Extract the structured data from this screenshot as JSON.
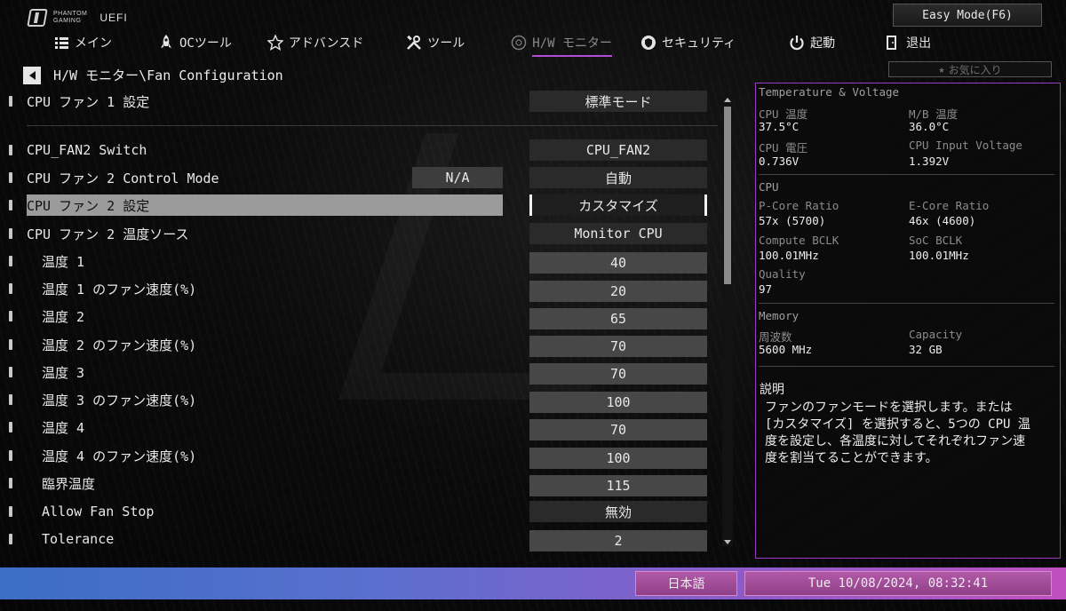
{
  "brand": {
    "line1": "PHANTOM",
    "line2": "GAMING",
    "uefi": "UEFI"
  },
  "easy_mode": "Easy Mode(F6)",
  "nav": [
    {
      "label": "メイン",
      "icon": "list-icon"
    },
    {
      "label": "OCツール",
      "icon": "rocket-icon"
    },
    {
      "label": "アドバンスド",
      "icon": "star-outline-icon"
    },
    {
      "label": "ツール",
      "icon": "tools-icon"
    },
    {
      "label": "H/W モニター",
      "icon": "monitor-circle-icon",
      "active": true
    },
    {
      "label": "セキュリティ",
      "icon": "shield-icon"
    },
    {
      "label": "起動",
      "icon": "power-icon"
    },
    {
      "label": "退出",
      "icon": "exit-icon"
    }
  ],
  "breadcrumb": "H/W モニター\\Fan Configuration",
  "favorites": "お気に入り",
  "settings": [
    {
      "label": "CPU ファン 1 設定",
      "value": "標準モード"
    },
    {
      "label": "CPU_FAN2 Switch",
      "value": "CPU_FAN2"
    },
    {
      "label": "CPU ファン 2 Control Mode",
      "extra": "N/A",
      "value": "自動"
    },
    {
      "label": "CPU ファン 2 設定",
      "value": "カスタマイズ"
    },
    {
      "label": "CPU ファン 2 温度ソース",
      "value": "Monitor CPU"
    },
    {
      "label": "温度 1",
      "value": "40"
    },
    {
      "label": "温度 1 のファン速度(%)",
      "value": "20"
    },
    {
      "label": "温度 2",
      "value": "65"
    },
    {
      "label": "温度 2 のファン速度(%)",
      "value": "70"
    },
    {
      "label": "温度 3",
      "value": "70"
    },
    {
      "label": "温度 3 のファン速度(%)",
      "value": "100"
    },
    {
      "label": "温度 4",
      "value": "70"
    },
    {
      "label": "温度 4 のファン速度(%)",
      "value": "100"
    },
    {
      "label": "臨界温度",
      "value": "115"
    },
    {
      "label": "Allow Fan Stop",
      "value": "無効"
    },
    {
      "label": "Tolerance",
      "value": "2"
    }
  ],
  "panel": {
    "temp_voltage": {
      "title": "Temperature & Voltage",
      "cpu_temp_label": "CPU 温度",
      "cpu_temp": "37.5°C",
      "mb_temp_label": "M/B 温度",
      "mb_temp": "36.0°C",
      "cpu_volt_label": "CPU 電圧",
      "cpu_volt": "0.736V",
      "cpu_input_label": "CPU Input Voltage",
      "cpu_input": "1.392V"
    },
    "cpu": {
      "title": "CPU",
      "pcore_label": "P-Core Ratio",
      "pcore": "57x (5700)",
      "ecore_label": "E-Core Ratio",
      "ecore": "46x (4600)",
      "cbclk_label": "Compute BCLK",
      "cbclk": "100.01MHz",
      "sbclk_label": "SoC BCLK",
      "sbclk": "100.01MHz",
      "quality_label": "Quality",
      "quality": "97"
    },
    "memory": {
      "title": "Memory",
      "freq_label": "周波数",
      "freq": "5600 MHz",
      "cap_label": "Capacity",
      "cap": "32 GB"
    },
    "desc_title": "説明",
    "desc_text": "ファンのファンモードを選択します。または [カスタマイズ] を選択すると、5つの CPU 温度を設定し、各温度に対してそれぞれファン速度を割当てることができます。"
  },
  "footer": {
    "language": "日本語",
    "datetime": "Tue 10/08/2024, 08:32:41"
  }
}
